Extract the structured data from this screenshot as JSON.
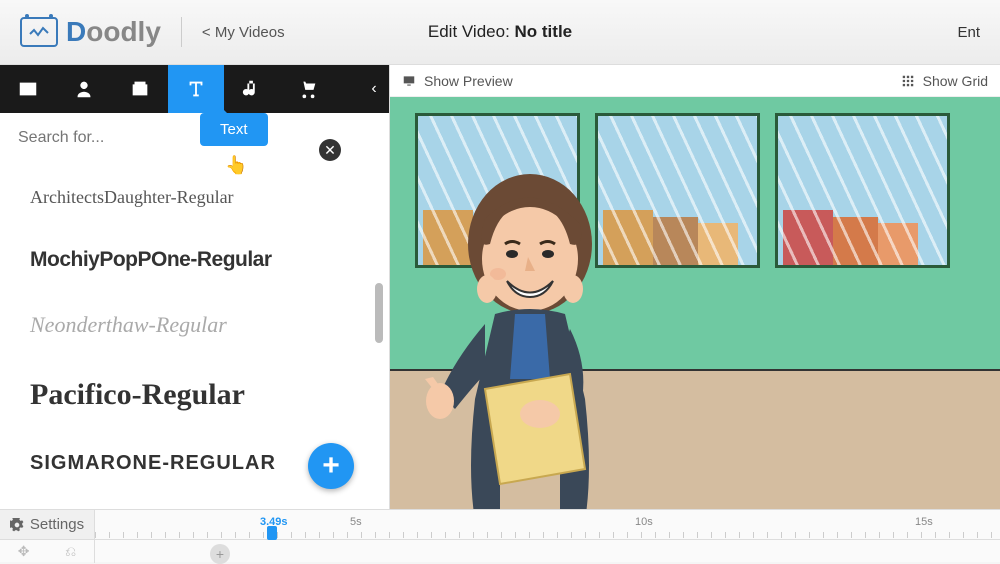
{
  "header": {
    "brand": "Doodly",
    "breadcrumb": "< My Videos",
    "title_prefix": "Edit Video: ",
    "title_name": "No title",
    "right_truncated": "Ent"
  },
  "sidebar": {
    "tooltip_label": "Text",
    "search_placeholder": "Search for...",
    "fonts": [
      "ArchitectsDaughter-Regular",
      "MochiyPopPOne-Regular",
      "Neonderthaw-Regular",
      "Pacifico-Regular",
      "SigmarOne-Regular"
    ]
  },
  "canvas_toolbar": {
    "preview": "Show Preview",
    "grid": "Show Grid"
  },
  "timeline": {
    "settings": "Settings",
    "current_time": "3.49s",
    "marks": [
      "5s",
      "10s",
      "15s"
    ]
  }
}
